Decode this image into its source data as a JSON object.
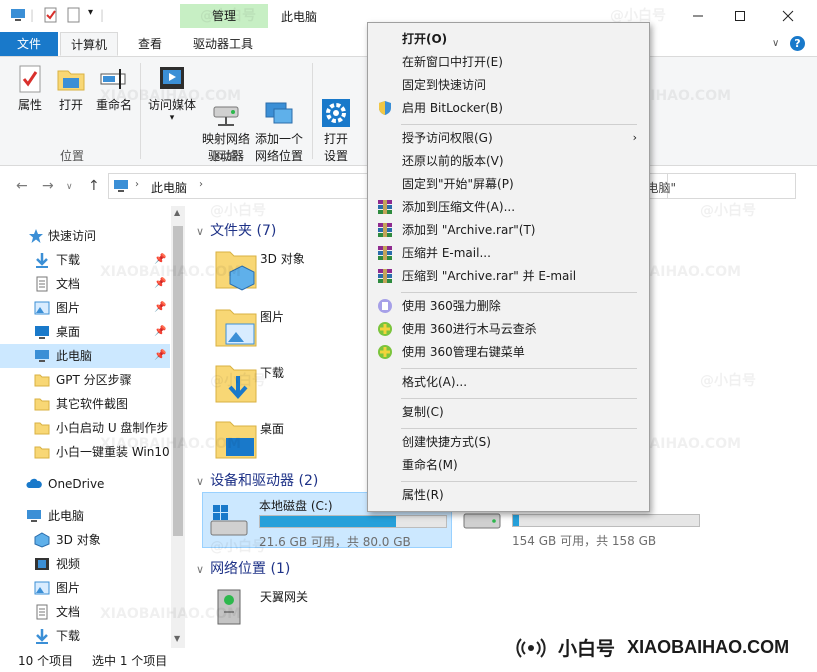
{
  "window": {
    "title": "此电脑",
    "context_tab_group": "管理"
  },
  "tabs": [
    "文件",
    "计算机",
    "查看",
    "驱动器工具"
  ],
  "ribbon": {
    "groups": [
      {
        "label": "位置",
        "buttons": [
          "属性",
          "打开",
          "重命名"
        ]
      },
      {
        "label": "网络",
        "buttons": [
          "访问媒体",
          "映射网络\n驱动器",
          "添加一个\n网络位置"
        ]
      },
      {
        "label": "",
        "buttons": [
          "打开\n设置"
        ]
      }
    ]
  },
  "address": {
    "path": [
      "此电脑"
    ],
    "search_placeholder": "索\"此电脑\""
  },
  "nav": [
    {
      "label": "快速访问",
      "icon": "star-icon"
    },
    {
      "label": "下载",
      "icon": "download-icon",
      "pinned": true
    },
    {
      "label": "文档",
      "icon": "document-icon",
      "pinned": true
    },
    {
      "label": "图片",
      "icon": "picture-icon",
      "pinned": true
    },
    {
      "label": "桌面",
      "icon": "desktop-icon",
      "pinned": true
    },
    {
      "label": "此电脑",
      "icon": "computer-icon",
      "pinned": true,
      "selected": true
    },
    {
      "label": "GPT 分区步骤",
      "icon": "folder-icon"
    },
    {
      "label": "其它软件截图",
      "icon": "folder-icon"
    },
    {
      "label": "小白启动 U 盘制作步",
      "icon": "folder-icon"
    },
    {
      "label": "小白一键重装 Win10",
      "icon": "folder-icon"
    },
    {
      "label": "OneDrive",
      "icon": "cloud-icon"
    },
    {
      "label": "此电脑",
      "icon": "computer-icon"
    },
    {
      "label": "3D 对象",
      "icon": "cube-icon"
    },
    {
      "label": "视频",
      "icon": "video-icon"
    },
    {
      "label": "图片",
      "icon": "picture-icon"
    },
    {
      "label": "文档",
      "icon": "document-icon"
    },
    {
      "label": "下载",
      "icon": "download-icon"
    }
  ],
  "content": {
    "folders_header": "文件夹 (7)",
    "folders": [
      "3D 对象",
      "图片",
      "下载",
      "桌面"
    ],
    "devices_header": "设备和驱动器 (2)",
    "drives": [
      {
        "name": "本地磁盘 (C:)",
        "info": "21.6 GB 可用，共 80.0 GB",
        "used_fraction": 0.73,
        "selected": true
      },
      {
        "name": "",
        "info": "154 GB 可用，共 158 GB",
        "used_fraction": 0.03,
        "selected": false
      }
    ],
    "network_header": "网络位置 (1)",
    "network": [
      "天翼网关"
    ]
  },
  "status": {
    "count": "10 个项目",
    "selection": "选中 1 个项目"
  },
  "context_menu": {
    "items": [
      {
        "label": "打开(O)",
        "bold": true
      },
      {
        "label": "在新窗口中打开(E)"
      },
      {
        "label": "固定到快速访问"
      },
      {
        "label": "启用 BitLocker(B)",
        "icon": "shield-icon"
      },
      {
        "sep": true
      },
      {
        "label": "授予访问权限(G)",
        "submenu": true
      },
      {
        "label": "还原以前的版本(V)"
      },
      {
        "label": "固定到\"开始\"屏幕(P)"
      },
      {
        "label": "添加到压缩文件(A)...",
        "icon": "winrar-icon"
      },
      {
        "label": "添加到 \"Archive.rar\"(T)",
        "icon": "winrar-icon"
      },
      {
        "label": "压缩并 E-mail...",
        "icon": "winrar-icon"
      },
      {
        "label": "压缩到 \"Archive.rar\" 并 E-mail",
        "icon": "winrar-icon"
      },
      {
        "sep": true
      },
      {
        "label": "使用 360强力删除",
        "icon": "360-delete-icon"
      },
      {
        "label": "使用 360进行木马云查杀",
        "icon": "360-scan-icon"
      },
      {
        "label": "使用 360管理右键菜单",
        "icon": "360-scan-icon"
      },
      {
        "sep": true
      },
      {
        "label": "格式化(A)..."
      },
      {
        "sep": true
      },
      {
        "label": "复制(C)"
      },
      {
        "sep": true
      },
      {
        "label": "创建快捷方式(S)"
      },
      {
        "label": "重命名(M)"
      },
      {
        "sep": true
      },
      {
        "label": "属性(R)"
      }
    ]
  },
  "brand": {
    "name": "小白号",
    "url": "XIAOBAIHAO.COM",
    "watermark_cn": "@小白号",
    "watermark_en": "XIAOBAIHAO.COM"
  },
  "colors": {
    "accent": "#1979ca",
    "selection": "#cce8ff",
    "manage_tab": "#c7efc4",
    "drive_fill": "#26a0da",
    "folder": "#f8d775"
  }
}
